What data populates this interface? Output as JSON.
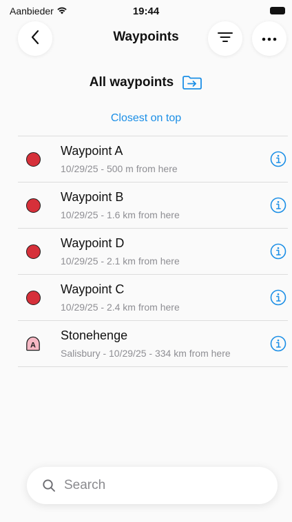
{
  "status_bar": {
    "carrier": "Aanbieder",
    "time": "19:44"
  },
  "header": {
    "title": "Waypoints"
  },
  "section": {
    "title": "All waypoints"
  },
  "sort": {
    "label": "Closest on top"
  },
  "waypoints": [
    {
      "name": "Waypoint A",
      "subtitle": "10/29/25 - 500 m from here",
      "icon": "red-dot-icon"
    },
    {
      "name": "Waypoint B",
      "subtitle": "10/29/25 - 1.6 km from here",
      "icon": "red-dot-icon"
    },
    {
      "name": "Waypoint D",
      "subtitle": "10/29/25 - 2.1 km from here",
      "icon": "red-dot-icon"
    },
    {
      "name": "Waypoint C",
      "subtitle": "10/29/25 - 2.4 km from here",
      "icon": "red-dot-icon"
    },
    {
      "name": "Stonehenge",
      "subtitle": "Salisbury - 10/29/25 - 334 km from here",
      "icon": "pink-marker-a-icon",
      "marker_letter": "A"
    }
  ],
  "search": {
    "placeholder": "Search",
    "value": ""
  },
  "colors": {
    "accent": "#1a8ee6",
    "waypoint_red": "#d6303a",
    "marker_pink": "#f6b8c4"
  }
}
